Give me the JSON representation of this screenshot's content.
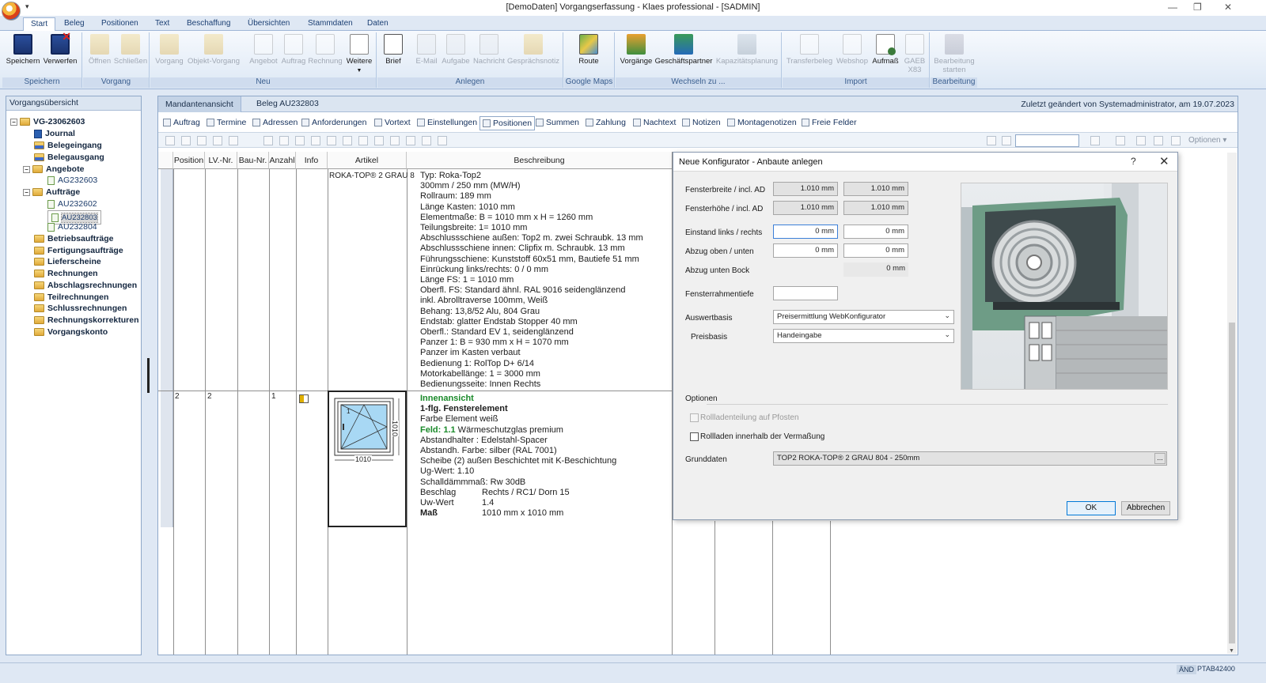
{
  "window": {
    "title": "[DemoDaten] Vorgangserfassung - Klaes professional - [SADMIN]",
    "quick_access": "▾",
    "minimize": "—",
    "restore": "❐",
    "close": "✕"
  },
  "menu": [
    "Start",
    "Beleg",
    "Positionen",
    "Text",
    "Beschaffung",
    "Übersichten",
    "Stammdaten",
    "Daten"
  ],
  "ribbon": {
    "groups": [
      "Speichern",
      "Vorgang",
      "Neu",
      "Anlegen",
      "Google Maps",
      "Wechseln zu ...",
      "Import",
      "Bearbeitung"
    ],
    "buttons": {
      "speichern": "Speichern",
      "verwerfen": "Verwerfen",
      "oeffnen": "Öffnen",
      "schliessen": "Schließen",
      "vorgang": "Vorgang",
      "objekt_vorgang": "Objekt-Vorgang",
      "angebot": "Angebot",
      "auftrag": "Auftrag",
      "rechnung": "Rechnung",
      "weitere": "Weitere",
      "brief": "Brief",
      "email": "E-Mail",
      "aufgabe": "Aufgabe",
      "nachricht": "Nachricht",
      "gespraechsnotiz": "Gesprächsnotiz",
      "route": "Route",
      "vorgaenge": "Vorgänge",
      "geschaeftspartner": "Geschäftspartner",
      "kapazitaetsplanung": "Kapazitätsplanung",
      "transferbeleg": "Transferbeleg",
      "webshop": "Webshop",
      "aufmass": "Aufmaß",
      "gaeb": "GAEB",
      "gaeb_sub": "X83",
      "bearbeitung": "Bearbeitung",
      "bearbeitung_sub": "starten"
    }
  },
  "left_panel": {
    "title": "Vorgangsübersicht",
    "root": "VG-23062603",
    "items": {
      "journal": "Journal",
      "belegeingang": "Belegeingang",
      "belegausgang": "Belegausgang",
      "angebote": "Angebote",
      "ag232603": "AG232603",
      "auftraege": "Aufträge",
      "au232602": "AU232602",
      "au232803": "AU232803",
      "au232804": "AU232804",
      "betriebsauftraege": "Betriebsaufträge",
      "fertigungsauftraege": "Fertigungsaufträge",
      "lieferscheine": "Lieferscheine",
      "rechnungen": "Rechnungen",
      "abschlagsrechnungen": "Abschlagsrechnungen",
      "teilrechnungen": "Teilrechnungen",
      "schlussrechnungen": "Schlussrechnungen",
      "rechnungskorrekturen": "Rechnungskorrekturen",
      "vorgangskonto": "Vorgangskonto"
    }
  },
  "main": {
    "tabs": [
      "Mandantenansicht",
      "Beleg AU232803"
    ],
    "last_changed": "Zuletzt geändert von Systemadministrator, am 19.07.2023",
    "subtabs": [
      "Auftrag",
      "Termine",
      "Adressen",
      "Anforderungen",
      "Vortext",
      "Einstellungen",
      "Positionen",
      "Summen",
      "Zahlung",
      "Nachtext",
      "Notizen",
      "Montagenotizen",
      "Freie Felder"
    ],
    "options_label": "Optionen",
    "columns": [
      "Position",
      "LV.-Nr.",
      "Bau-Nr.",
      "Anzahl",
      "Info",
      "Artikel",
      "Beschreibung"
    ],
    "row1": {
      "artikel": "ROKA-TOP® 2 GRAU 8",
      "desc": [
        "Typ: Roka-Top2",
        "300mm / 250 mm (MW/H)",
        "Rollraum: 189 mm",
        "Länge Kasten: 1010 mm",
        "Elementmaße: B = 1010 mm x H = 1260 mm",
        "Teilungsbreite: 1= 1010 mm",
        "Abschlussschiene außen: Top2 m. zwei Schraubk. 13 mm",
        "Abschlussschiene innen: Clipfix m. Schraubk. 13 mm",
        "Führungsschiene: Kunststoff 60x51 mm, Bautiefe 51 mm",
        "Einrückung links/rechts: 0 / 0 mm",
        "Länge FS: 1 = 1010 mm",
        "Oberfl. FS: Standard ähnl. RAL 9016 seidenglänzend",
        "inkl. Abrolltraverse 100mm, Weiß",
        "Behang: 13,8/52 Alu, 804 Grau",
        "Endstab: glatter Endstab Stopper 40 mm",
        "Oberfl.: Standard EV 1, seidenglänzend",
        "Panzer 1: B = 930 mm x H = 1070 mm",
        "Panzer im Kasten verbaut",
        "Bedienung 1: RolTop D+ 6/14",
        "Motorkabellänge: 1 = 3000 mm",
        "Bedienungsseite: Innen Rechts"
      ]
    },
    "row2": {
      "position": "2",
      "lv": "2",
      "anzahl": "1",
      "dim_w": "1010",
      "dim_h": "1010",
      "field_no": "1",
      "innenansicht": "Innenansicht",
      "element": "1-flg. Fensterelement",
      "farbe": "Farbe Element  weiß",
      "feld_label": "Feld: 1.1",
      "feld_value": " Wärmeschutzglas premium",
      "lines": [
        "Abstandhalter : Edelstahl-Spacer",
        "Abstandh. Farbe: silber (RAL 7001)",
        "Scheibe (2) außen Beschichtet mit K-Beschichtung",
        "Ug-Wert: 1.10",
        "Schalldämmmaß: Rw 30dB"
      ],
      "beschlag_k": "Beschlag",
      "beschlag_v": "Rechts / RC1/ Dorn 15",
      "uw_k": "Uw-Wert",
      "uw_v": "1.4",
      "mass_k": "Maß",
      "mass_v": "1010 mm x 1010 mm"
    }
  },
  "dialog": {
    "title": "Neue Konfigurator - Anbaute anlegen",
    "help": "?",
    "close": "✕",
    "fensterbreite_label": "Fensterbreite / incl. AD",
    "fensterbreite_1": "1.010 mm",
    "fensterbreite_2": "1.010 mm",
    "fensterhoehe_label": "Fensterhöhe / incl. AD",
    "fensterhoehe_1": "1.010 mm",
    "fensterhoehe_2": "1.010 mm",
    "einstand_label": "Einstand links / rechts",
    "einstand_1": "0 mm",
    "einstand_2": "0 mm",
    "abzug_label": "Abzug oben / unten",
    "abzug_1": "0 mm",
    "abzug_2": "0 mm",
    "abzug_bock_label": "Abzug unten Bock",
    "abzug_bock": "0 mm",
    "rahmentiefe_label": "Fensterrahmentiefe",
    "rahmentiefe": "",
    "auswertbasis_label": "Auswertbasis",
    "auswertbasis": "Preisermittlung WebKonfigurator",
    "preisbasis_label": "Preisbasis",
    "preisbasis": "Handeingabe",
    "optionen_label": "Optionen",
    "opt1": "Rollladenteilung auf Pfosten",
    "opt2": "Rollladen innerhalb der Vermaßung",
    "grunddaten_label": "Grunddaten",
    "grunddaten": "TOP2 ROKA-TOP® 2 GRAU 804 - 250mm",
    "browse": "...",
    "ok": "OK",
    "cancel": "Abbrechen"
  },
  "status": {
    "mode": "ÄND",
    "code": "PTAB42400"
  }
}
